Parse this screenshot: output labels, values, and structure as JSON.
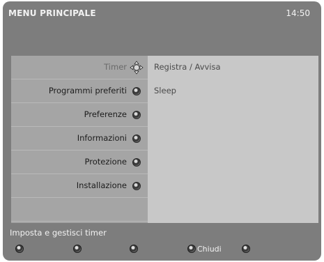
{
  "header": {
    "title": "MENU PRINCIPALE",
    "clock": "14:50"
  },
  "menu": {
    "items": [
      {
        "label": "Timer",
        "selected": true,
        "icon": "dpad-icon"
      },
      {
        "label": "Programmi preferiti",
        "icon": "bullet-icon"
      },
      {
        "label": "Preferenze",
        "icon": "bullet-icon"
      },
      {
        "label": "Informazioni",
        "icon": "bullet-icon"
      },
      {
        "label": "Protezione",
        "icon": "bullet-icon"
      },
      {
        "label": "Installazione",
        "icon": "bullet-icon"
      }
    ]
  },
  "submenu": {
    "items": [
      "Registra / Avvisa",
      "Sleep"
    ]
  },
  "status": {
    "hint": "Imposta e gestisci timer"
  },
  "footer": {
    "buttons": [
      {
        "label": "",
        "icon": "red-key-icon"
      },
      {
        "label": "",
        "icon": "green-key-icon"
      },
      {
        "label": "",
        "icon": "yellow-key-icon"
      },
      {
        "label": "Chiudi",
        "icon": "blue-key-icon"
      },
      {
        "label": "",
        "icon": "options-key-icon"
      }
    ]
  },
  "colors": {
    "background": "#7d7d7d",
    "left_panel": "#a5a5a5",
    "right_panel": "#c8c8c8",
    "text_light": "#f2f2f2"
  }
}
